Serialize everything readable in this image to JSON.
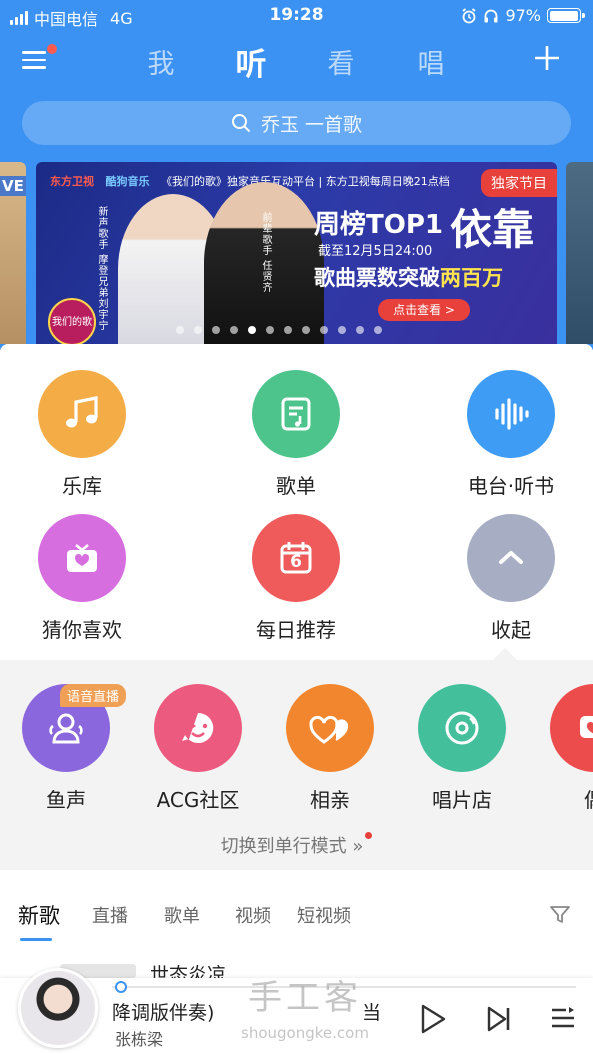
{
  "status_bar": {
    "carrier": "中国电信",
    "network": "4G",
    "time": "19:28",
    "battery": "97%",
    "battery_level": 0.97
  },
  "top_nav": {
    "tabs": [
      "我",
      "听",
      "看",
      "唱"
    ],
    "active_tab": "听",
    "menu_has_badge": true
  },
  "search": {
    "placeholder": "乔玉 一首歌"
  },
  "banner": {
    "side_left_text": "VE",
    "logo_dongfang": "东方卫视",
    "logo_kuwo": "酷狗音乐",
    "top_line": "《我们的歌》独家音乐互动平台 | 东方卫视每周日晚21点档",
    "badge": "独家节目",
    "singer1_caption": "新声歌手 摩登兄弟刘宇宁",
    "singer2_caption": "前辈歌手 任贤齐",
    "show_logo": "我们的歌",
    "title": "周榜TOP1",
    "title_big": "依靠",
    "deadline": "截至12月5日24:00",
    "subtitle_prefix": "歌曲票数突破",
    "subtitle_highlight": "两百万",
    "cta": "点击查看 >",
    "dots_total": 12,
    "dots_active_index": 4
  },
  "grid": [
    {
      "label": "乐库",
      "icon": "music-note-icon",
      "color": "#f4ac47"
    },
    {
      "label": "歌单",
      "icon": "playlist-icon",
      "color": "#4ec48d"
    },
    {
      "label": "电台·听书",
      "icon": "soundwave-icon",
      "color": "#3e9cf5"
    },
    {
      "label": "猜你喜欢",
      "icon": "radio-heart-icon",
      "color": "#d76ee0"
    },
    {
      "label": "每日推荐",
      "icon": "calendar-icon",
      "color": "#ef5a5a",
      "calendar_day": "6"
    },
    {
      "label": "收起",
      "icon": "chevron-up-icon",
      "color": "#a7aec4"
    }
  ],
  "shortcuts": [
    {
      "label": "鱼声",
      "icon": "people-icon",
      "color": "#8a67dc",
      "tag": "语音直播"
    },
    {
      "label": "ACG社区",
      "icon": "wink-face-icon",
      "color": "#ec5a7f"
    },
    {
      "label": "相亲",
      "icon": "hearts-icon",
      "color": "#f1862f"
    },
    {
      "label": "唱片店",
      "icon": "vinyl-icon",
      "color": "#44bf9c"
    },
    {
      "label": "偶",
      "icon": "heart-chat-icon",
      "color": "#ec4c4c"
    }
  ],
  "switch_mode": "切换到单行模式 »",
  "content_tabs": [
    "新歌",
    "直播",
    "歌单",
    "视频",
    "短视频"
  ],
  "content_active_tab": "新歌",
  "peek_title": "世态炎凉",
  "player": {
    "song": "降调版伴奏)",
    "artist": "张栋梁",
    "song_tail": "当",
    "progress": 0.01
  },
  "watermark": {
    "cn": "手工客",
    "url": "shougongke.com"
  }
}
